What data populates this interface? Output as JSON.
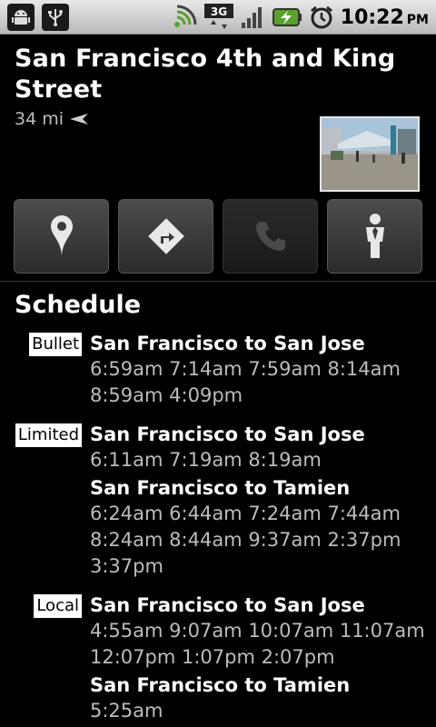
{
  "status_bar": {
    "icons": [
      "android-debug-icon",
      "usb-icon",
      "wifi-signal-icon",
      "3g-icon",
      "cell-signal-icon",
      "battery-charging-icon",
      "alarm-clock-icon"
    ],
    "time": "10:22",
    "ampm": "PM"
  },
  "station": {
    "title": "San Francisco 4th and King Street",
    "distance": "34 mi"
  },
  "actions": [
    {
      "name": "map-pin-button",
      "icon": "map-pin-icon",
      "enabled": true
    },
    {
      "name": "directions-button",
      "icon": "directions-icon",
      "enabled": true
    },
    {
      "name": "call-button",
      "icon": "phone-icon",
      "enabled": false
    },
    {
      "name": "street-view-button",
      "icon": "pegman-icon",
      "enabled": true
    }
  ],
  "schedule": {
    "title": "Schedule",
    "groups": [
      {
        "tag": "Bullet",
        "routes": [
          {
            "name": "San Francisco to San Jose",
            "times": "6:59am 7:14am 7:59am 8:14am 8:59am 4:09pm"
          }
        ]
      },
      {
        "tag": "Limited",
        "routes": [
          {
            "name": "San Francisco to San Jose",
            "times": "6:11am 7:19am 8:19am"
          },
          {
            "name": "San Francisco to Tamien",
            "times": "6:24am 6:44am 7:24am 7:44am 8:24am 8:44am 9:37am 2:37pm 3:37pm"
          }
        ]
      },
      {
        "tag": "Local",
        "routes": [
          {
            "name": "San Francisco to San Jose",
            "times": "4:55am 9:07am 10:07am 11:07am 12:07pm 1:07pm 2:07pm"
          },
          {
            "name": "San Francisco to Tamien",
            "times": "5:25am"
          }
        ]
      }
    ]
  }
}
